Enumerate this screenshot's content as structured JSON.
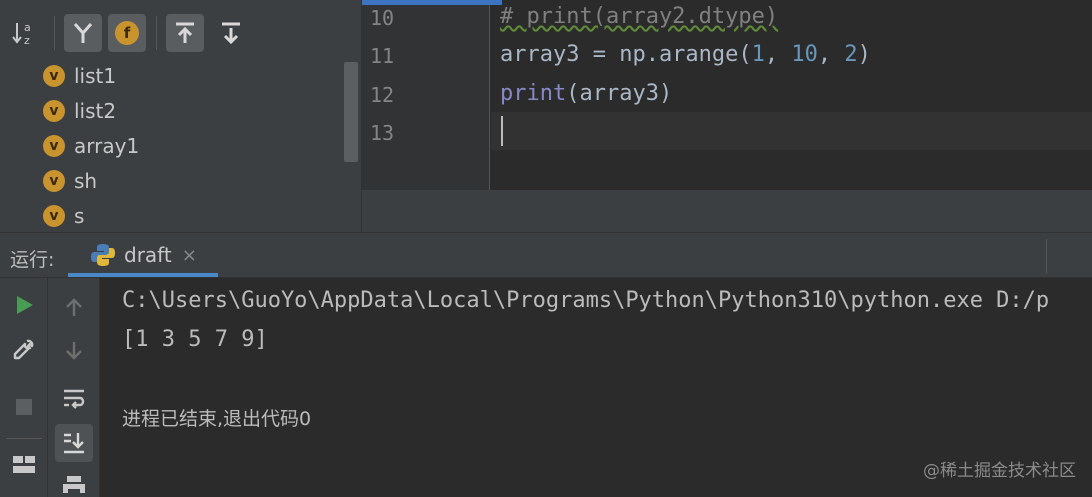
{
  "structure": {
    "items": [
      {
        "badge": "v",
        "label": "list1"
      },
      {
        "badge": "v",
        "label": "list2"
      },
      {
        "badge": "v",
        "label": "array1"
      },
      {
        "badge": "v",
        "label": "sh"
      },
      {
        "badge": "v",
        "label": "s"
      }
    ],
    "toolbar": {
      "sort_alpha_icon": "sort-alphabetically-icon",
      "show_inherited_icon": "show-inherited-icon",
      "show_fields_label": "f",
      "expand_icon": "expand-all-icon",
      "collapse_icon": "collapse-all-icon"
    }
  },
  "editor": {
    "lines": [
      {
        "number": "10",
        "text": "# print(array2.dtype)"
      },
      {
        "number": "11",
        "parts": [
          "array3 = np.arange(",
          "1",
          ", ",
          "10",
          ", ",
          "2",
          ")"
        ]
      },
      {
        "number": "12",
        "parts": [
          "print",
          "(array3)"
        ]
      },
      {
        "number": "13",
        "text": ""
      }
    ]
  },
  "run": {
    "label": "运行:",
    "tab": {
      "name": "draft",
      "close": "×"
    },
    "console": [
      "C:\\Users\\GuoYo\\AppData\\Local\\Programs\\Python\\Python310\\python.exe D:/p",
      "[1 3 5 7 9]",
      "",
      "进程已结束,退出代码0"
    ]
  },
  "watermark": "@稀土掘金技术社区",
  "colors": {
    "panel": "#3c3f41",
    "editor_bg": "#2b2b2b",
    "number": "#6897bb",
    "keyword": "#8888c6",
    "comment": "#808080",
    "badge": "#c9942e",
    "run_green": "#499c54"
  }
}
